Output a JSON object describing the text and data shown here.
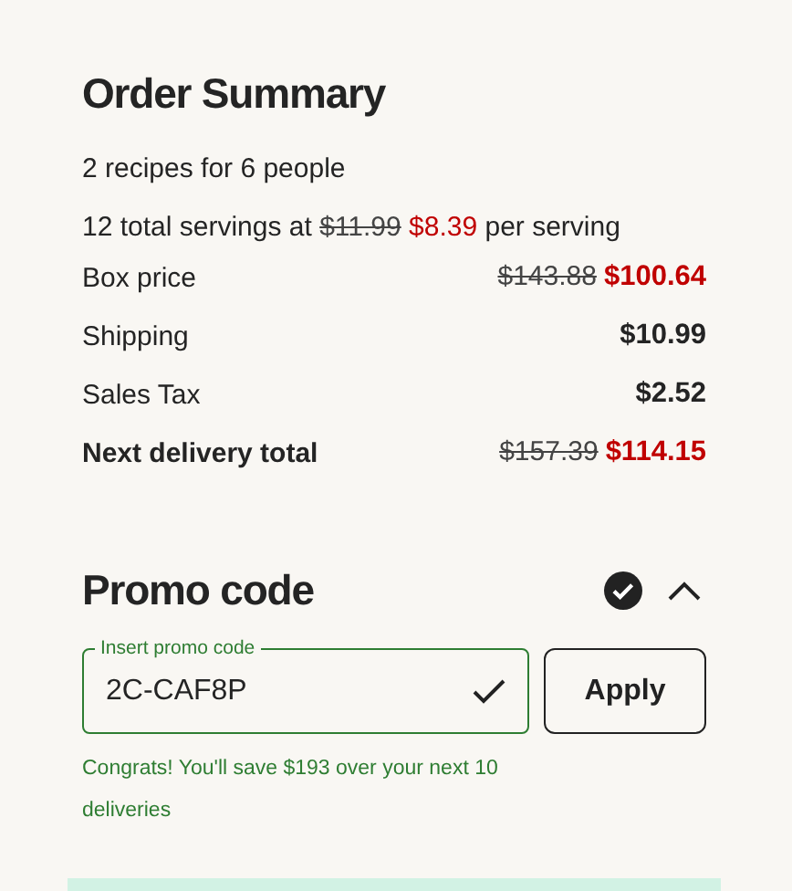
{
  "order_summary": {
    "title": "Order Summary",
    "recipes": "2 recipes for 6 people",
    "servings": {
      "prefix": "12 total servings at",
      "old_price": "$11.99",
      "new_price": "$8.39",
      "suffix": "per serving"
    },
    "rows": [
      {
        "label": "Box price",
        "old_price": "$143.88",
        "price": "$100.64",
        "discounted": true,
        "emphasis": false
      },
      {
        "label": "Shipping",
        "price": "$10.99",
        "discounted": false,
        "emphasis": false
      },
      {
        "label": "Sales Tax",
        "price": "$2.52",
        "discounted": false,
        "emphasis": false
      },
      {
        "label": "Next delivery total",
        "old_price": "$157.39",
        "price": "$114.15",
        "discounted": true,
        "emphasis": true
      }
    ]
  },
  "promo": {
    "title": "Promo code",
    "applied": true,
    "expanded": true,
    "field": {
      "label": "Insert promo code",
      "value": "2C-CAF8P",
      "valid": true
    },
    "apply_button": "Apply",
    "message": "Congrats! You'll save $193 over your next 10 deliveries"
  }
}
